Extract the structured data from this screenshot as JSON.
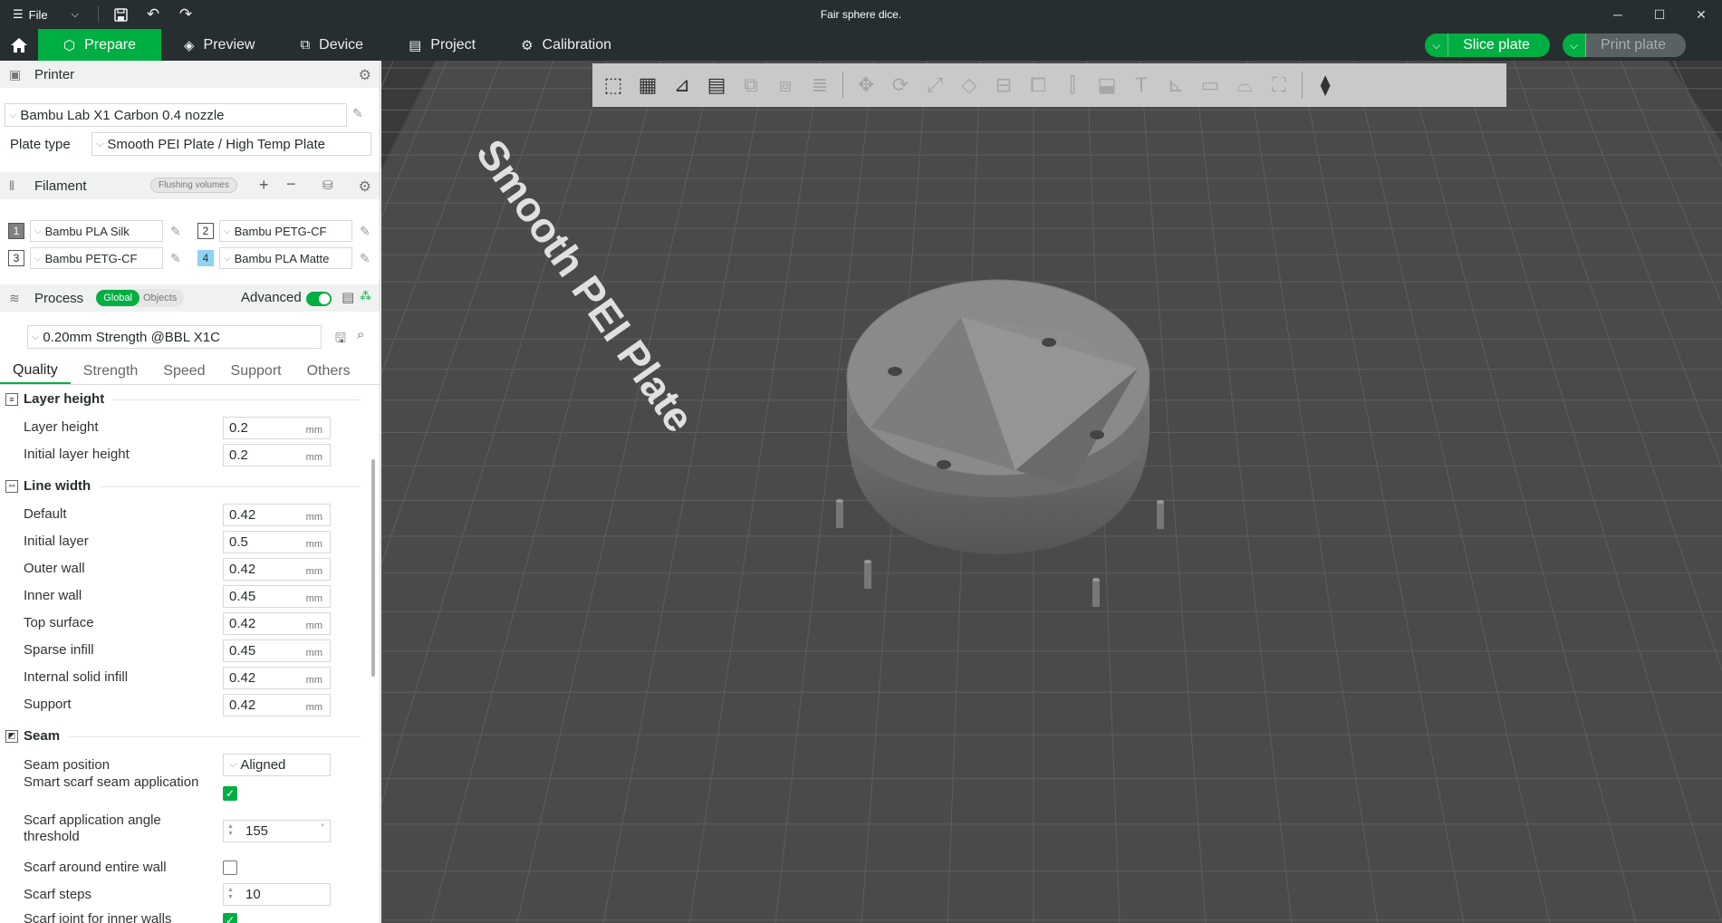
{
  "window": {
    "title": "Fair sphere dice.",
    "file_menu": "File",
    "minimize_icon": "minimize-icon",
    "maximize_icon": "maximize-icon",
    "close_icon": "close-icon"
  },
  "nav": {
    "tabs": [
      {
        "label": "Prepare",
        "icon": "cube-icon",
        "active": true
      },
      {
        "label": "Preview",
        "icon": "layers-icon",
        "active": false
      },
      {
        "label": "Device",
        "icon": "device-icon",
        "active": false
      },
      {
        "label": "Project",
        "icon": "project-icon",
        "active": false
      },
      {
        "label": "Calibration",
        "icon": "gear-icon",
        "active": false
      }
    ],
    "slice_plate": "Slice plate",
    "print_plate": "Print plate"
  },
  "printer": {
    "header": "Printer",
    "model": "Bambu Lab X1 Carbon 0.4 nozzle",
    "plate_type_label": "Plate type",
    "plate_type": "Smooth PEI Plate / High Temp Plate"
  },
  "filament": {
    "header": "Filament",
    "flushing_volumes": "Flushing volumes",
    "items": [
      {
        "num": "1",
        "name": "Bambu PLA Silk",
        "color": "#808080"
      },
      {
        "num": "2",
        "name": "Bambu PETG-CF",
        "color": "#ffffff"
      },
      {
        "num": "3",
        "name": "Bambu PETG-CF",
        "color": "#ffffff"
      },
      {
        "num": "4",
        "name": "Bambu PLA Matte",
        "color": "#8fd2f2"
      }
    ]
  },
  "process": {
    "header": "Process",
    "global": "Global",
    "objects": "Objects",
    "advanced": "Advanced",
    "preset": "0.20mm Strength @BBL X1C",
    "tabs": [
      "Quality",
      "Strength",
      "Speed",
      "Support",
      "Others"
    ]
  },
  "quality": {
    "layer_height_group": "Layer height",
    "layer_height_label": "Layer height",
    "layer_height": "0.2",
    "initial_layer_height_label": "Initial layer height",
    "initial_layer_height": "0.2",
    "line_width_group": "Line width",
    "line_widths": [
      {
        "label": "Default",
        "value": "0.42"
      },
      {
        "label": "Initial layer",
        "value": "0.5"
      },
      {
        "label": "Outer wall",
        "value": "0.42"
      },
      {
        "label": "Inner wall",
        "value": "0.45"
      },
      {
        "label": "Top surface",
        "value": "0.42"
      },
      {
        "label": "Sparse infill",
        "value": "0.45"
      },
      {
        "label": "Internal solid infill",
        "value": "0.42"
      },
      {
        "label": "Support",
        "value": "0.42"
      }
    ],
    "unit": "mm",
    "seam_group": "Seam",
    "seam_position_label": "Seam position",
    "seam_position": "Aligned",
    "smart_scarf_label": "Smart scarf seam application",
    "smart_scarf_checked": true,
    "scarf_angle_label": "Scarf application angle threshold",
    "scarf_angle": "155",
    "scarf_entire_wall_label": "Scarf around entire wall",
    "scarf_entire_wall_checked": false,
    "scarf_steps_label": "Scarf steps",
    "scarf_steps": "10",
    "scarf_inner_label": "Scarf joint for inner walls"
  },
  "plate": {
    "plate_text": "Smooth PEI Plate",
    "bed_color": "#4a4a4a",
    "model_color": "#8a8a8a"
  }
}
